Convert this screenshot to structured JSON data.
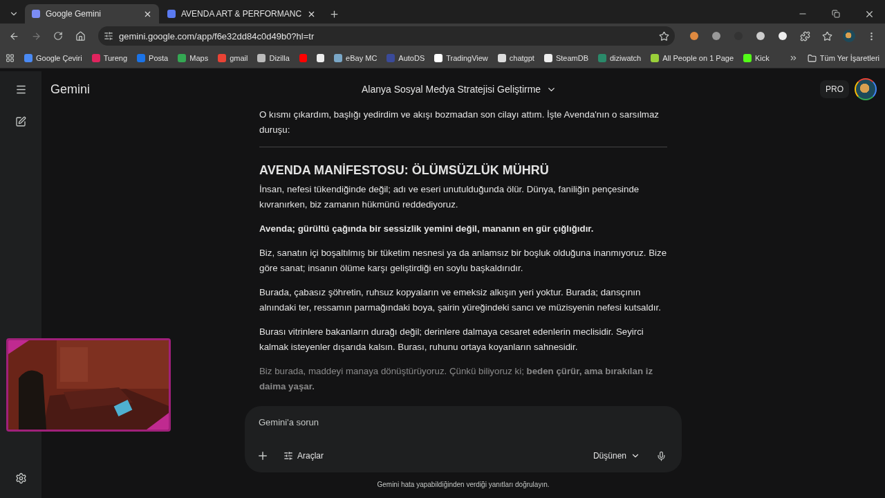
{
  "tabs": [
    {
      "title": "Google Gemini",
      "selected": true
    },
    {
      "title": "AVENDA ART & PERFORMANC",
      "selected": false
    }
  ],
  "address": "gemini.google.com/app/f6e32dd84c0d49b0?hl=tr",
  "bookmarks": [
    {
      "label": "Google Çeviri",
      "color": "#4a8af4"
    },
    {
      "label": "Tureng",
      "color": "#e0245e"
    },
    {
      "label": "Posta",
      "color": "#1a73e8"
    },
    {
      "label": "Maps",
      "color": "#34a853"
    },
    {
      "label": "gmail",
      "color": "#ea4335"
    },
    {
      "label": "Dizilla",
      "color": "#bbbbbb"
    },
    {
      "kind": "icon",
      "color": "#ff0000"
    },
    {
      "kind": "icon",
      "color": "#eeeeee"
    },
    {
      "label": "eBay MC",
      "color": "#7aa7c7"
    },
    {
      "label": "AutoDS",
      "color": "#3a4a9a"
    },
    {
      "label": "TradingView",
      "color": "#ffffff"
    },
    {
      "label": "chatgpt",
      "color": "#dddddd"
    },
    {
      "label": "SteamDB",
      "color": "#eeeeee"
    },
    {
      "label": "diziwatch",
      "color": "#2a8a6a"
    },
    {
      "label": "All People on 1 Page",
      "color": "#9ad03a"
    },
    {
      "label": "Kick",
      "color": "#53fc18"
    }
  ],
  "all_bookmarks": "Tüm Yer İşaretleri",
  "app_title": "Gemini",
  "chat_title": "Alanya Sosyal Medya Stratejisi Geliştirme",
  "plan_badge": "PRO",
  "intro": "O kısmı çıkardım, başlığı yedirdim ve akışı bozmadan son cilayı attım. İşte Avenda'nın o sarsılmaz duruşu:",
  "heading": "AVENDA MANİFESTOSU: ÖLÜMSÜZLÜK MÜHRÜ",
  "paragraphs": [
    {
      "text": "İnsan, nefesi tükendiğinde değil; adı ve eseri unutulduğunda ölür. Dünya, faniliğin pençesinde kıvranırken, biz zamanın hükmünü reddediyoruz.",
      "bold": false,
      "faded": false
    },
    {
      "text": "Avenda; gürültü çağında bir sessizlik yemini değil, mananın en gür çığlığıdır.",
      "bold": true,
      "faded": false
    },
    {
      "text": "Biz, sanatın içi boşaltılmış bir tüketim nesnesi ya da anlamsız bir boşluk olduğuna inanmıyoruz. Bize göre sanat; insanın ölüme karşı geliştirdiği en soylu başkaldırıdır.",
      "bold": false,
      "faded": false
    },
    {
      "text": "Burada, çabasız şöhretin, ruhsuz kopyaların ve emeksiz alkışın yeri yoktur. Burada; dansçının alnındaki ter, ressamın parmağındaki boya, şairin yüreğindeki sancı ve müzisyenin nefesi kutsaldır.",
      "bold": false,
      "faded": false
    },
    {
      "text": "Burası vitrinlere bakanların durağı değil; derinlere dalmaya cesaret edenlerin meclisidir. Seyirci kalmak isteyenler dışarıda kalsın. Burası, ruhunu ortaya koyanların sahnesidir.",
      "bold": false,
      "faded": false
    },
    {
      "text": "Biz burada, maddeyi manaya dönüştürüyoruz. Çünkü biliyoruz ki; **beden çürür, ama bırakılan iz daima yaşar.**",
      "bold": false,
      "faded": true
    }
  ],
  "composer": {
    "placeholder": "Gemini'a sorun",
    "tools": "Araçlar",
    "mode": "Düşünen"
  },
  "disclaimer": "Gemini hata yapabildiğinden verdiği yanıtları doğrulayın."
}
